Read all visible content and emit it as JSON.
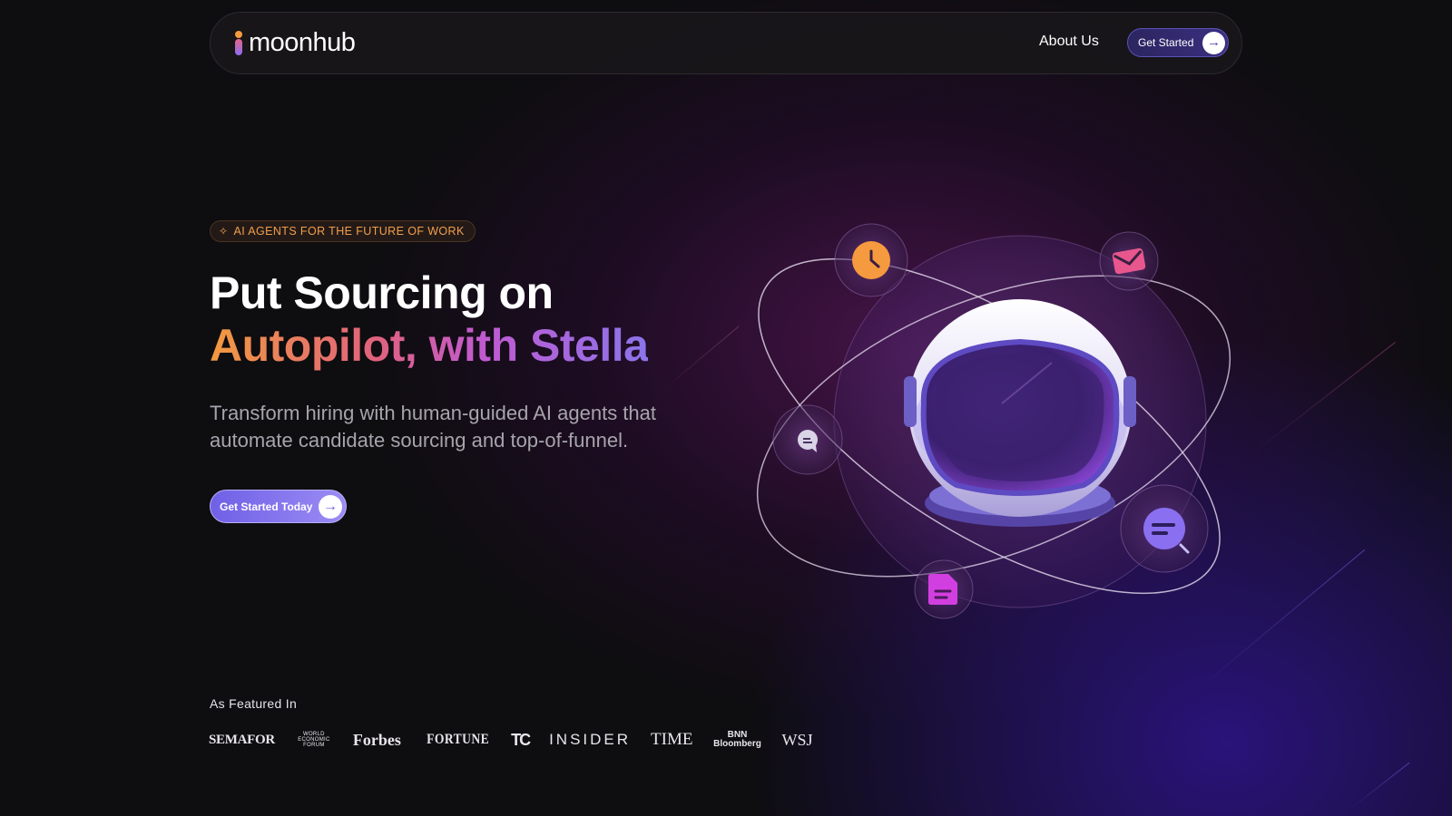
{
  "nav": {
    "logo_text": "moonhub",
    "about_label": "About Us",
    "cta_label": "Get Started",
    "cta_icon": "arrow-right-icon"
  },
  "hero": {
    "badge_icon": "sparkle-icon",
    "badge_text": "AI AGENTS FOR THE FUTURE OF WORK",
    "headline_line1": "Put Sourcing on",
    "headline_line2": "Autopilot, with Stella",
    "subtext": "Transform hiring with human-guided AI agents that automate candidate sourcing and top-of-funnel.",
    "cta_label": "Get Started Today",
    "cta_icon": "arrow-right-icon"
  },
  "featured": {
    "label": "As Featured In",
    "logos": {
      "semafor": "SEMAFOR",
      "wef": "WORLD ECONOMIC FORUM",
      "forbes": "Forbes",
      "fortune": "FORTUNE",
      "tc": "TC",
      "insider": "INSIDER",
      "time": "TIME",
      "bnn": "BNN Bloomberg",
      "wsj": "WSJ"
    }
  },
  "illustration": {
    "icons": [
      "clock-icon",
      "mail-icon",
      "chat-icon",
      "search-list-icon",
      "document-icon",
      "astronaut-helmet"
    ],
    "colors": {
      "clock": "#f59a3e",
      "mail": "#e8568e",
      "chat": "#d9d4e6",
      "search": "#8a6ff0",
      "document": "#d23fe0"
    }
  },
  "colors": {
    "accent_orange": "#f29a3f",
    "accent_pink": "#e0627e",
    "accent_purple": "#8b74ea",
    "cta_purple": "#7a6be8",
    "background": "#0e0d10"
  }
}
